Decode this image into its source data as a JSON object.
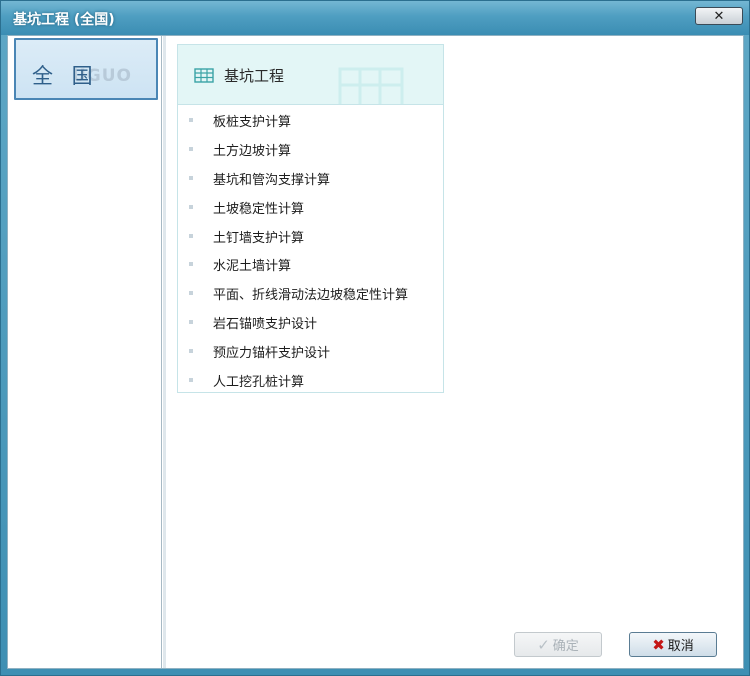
{
  "window": {
    "title": "基坑工程 (全国)",
    "close_icon": "close-icon"
  },
  "sidebar": {
    "items": [
      {
        "label": "全 国",
        "watermark": "UGUO",
        "selected": true
      }
    ]
  },
  "card": {
    "title": "基坑工程",
    "icon": "grid-table-icon",
    "items": [
      {
        "label": "板桩支护计算"
      },
      {
        "label": "土方边坡计算"
      },
      {
        "label": "基坑和管沟支撑计算"
      },
      {
        "label": "土坡稳定性计算"
      },
      {
        "label": "土钉墙支护计算"
      },
      {
        "label": "水泥土墙计算"
      },
      {
        "label": "平面、折线滑动法边坡稳定性计算"
      },
      {
        "label": "岩石锚喷支护设计"
      },
      {
        "label": "预应力锚杆支护设计"
      },
      {
        "label": "人工挖孔桩计算"
      }
    ]
  },
  "footer": {
    "ok_label": "确定",
    "ok_icon": "check-icon",
    "ok_enabled": false,
    "cancel_label": "取消",
    "cancel_icon": "x-mark-icon"
  },
  "colors": {
    "titlebar": "#4e9ec1",
    "card_header": "#e3f6f6",
    "nav_selected": "#cde3f3",
    "cancel_icon": "#c41616"
  }
}
